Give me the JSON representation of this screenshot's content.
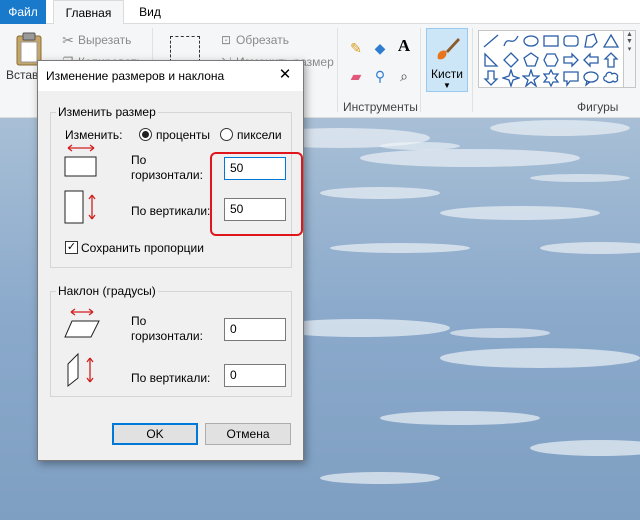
{
  "tabs": {
    "file": "Файл",
    "home": "Главная",
    "view": "Вид"
  },
  "ribbon": {
    "paste": "Встав",
    "cut": "Вырезать",
    "copy": "Копировать",
    "crop": "Обрезать",
    "resize": "Изменить размер",
    "tools_caption": "Инструменты",
    "brushes": "Кисти",
    "shapes_caption": "Фигуры"
  },
  "dialog": {
    "title": "Изменение размеров и наклона",
    "resize_group": "Изменить размер",
    "by_label": "Изменить:",
    "option_percent": "проценты",
    "option_pixels": "пиксели",
    "selected_option": "проценты",
    "horizontal_label_1": "По",
    "horizontal_label_2": "горизонтали:",
    "vertical_label": "По вертикали:",
    "resize_horizontal": "50",
    "resize_vertical": "50",
    "keep_ratio": "Сохранить пропорции",
    "keep_ratio_checked": true,
    "skew_group": "Наклон (градусы)",
    "skew_horizontal": "0",
    "skew_vertical": "0",
    "ok": "OK",
    "cancel": "Отмена"
  },
  "colors": {
    "accent": "#0078d7",
    "file_tab": "#1979ca",
    "annotation": "#e0161d"
  }
}
